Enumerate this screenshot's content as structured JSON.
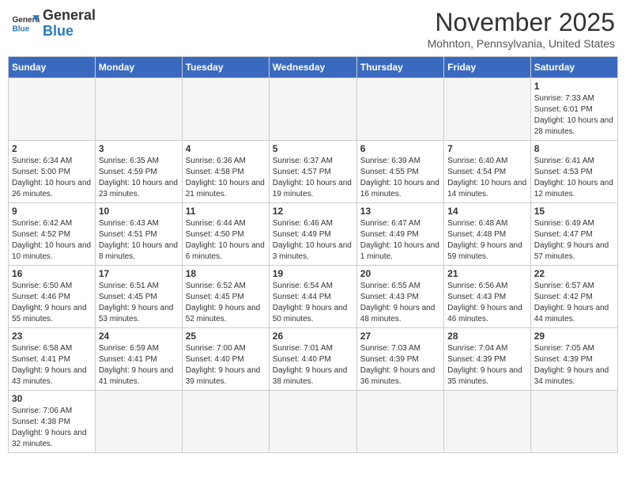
{
  "header": {
    "logo_general": "General",
    "logo_blue": "Blue",
    "title": "November 2025",
    "location": "Mohnton, Pennsylvania, United States"
  },
  "days_of_week": [
    "Sunday",
    "Monday",
    "Tuesday",
    "Wednesday",
    "Thursday",
    "Friday",
    "Saturday"
  ],
  "weeks": [
    [
      {
        "day": "",
        "info": ""
      },
      {
        "day": "",
        "info": ""
      },
      {
        "day": "",
        "info": ""
      },
      {
        "day": "",
        "info": ""
      },
      {
        "day": "",
        "info": ""
      },
      {
        "day": "",
        "info": ""
      },
      {
        "day": "1",
        "info": "Sunrise: 7:33 AM\nSunset: 6:01 PM\nDaylight: 10 hours and 28 minutes."
      }
    ],
    [
      {
        "day": "2",
        "info": "Sunrise: 6:34 AM\nSunset: 5:00 PM\nDaylight: 10 hours and 26 minutes."
      },
      {
        "day": "3",
        "info": "Sunrise: 6:35 AM\nSunset: 4:59 PM\nDaylight: 10 hours and 23 minutes."
      },
      {
        "day": "4",
        "info": "Sunrise: 6:36 AM\nSunset: 4:58 PM\nDaylight: 10 hours and 21 minutes."
      },
      {
        "day": "5",
        "info": "Sunrise: 6:37 AM\nSunset: 4:57 PM\nDaylight: 10 hours and 19 minutes."
      },
      {
        "day": "6",
        "info": "Sunrise: 6:39 AM\nSunset: 4:55 PM\nDaylight: 10 hours and 16 minutes."
      },
      {
        "day": "7",
        "info": "Sunrise: 6:40 AM\nSunset: 4:54 PM\nDaylight: 10 hours and 14 minutes."
      },
      {
        "day": "8",
        "info": "Sunrise: 6:41 AM\nSunset: 4:53 PM\nDaylight: 10 hours and 12 minutes."
      }
    ],
    [
      {
        "day": "9",
        "info": "Sunrise: 6:42 AM\nSunset: 4:52 PM\nDaylight: 10 hours and 10 minutes."
      },
      {
        "day": "10",
        "info": "Sunrise: 6:43 AM\nSunset: 4:51 PM\nDaylight: 10 hours and 8 minutes."
      },
      {
        "day": "11",
        "info": "Sunrise: 6:44 AM\nSunset: 4:50 PM\nDaylight: 10 hours and 6 minutes."
      },
      {
        "day": "12",
        "info": "Sunrise: 6:46 AM\nSunset: 4:49 PM\nDaylight: 10 hours and 3 minutes."
      },
      {
        "day": "13",
        "info": "Sunrise: 6:47 AM\nSunset: 4:49 PM\nDaylight: 10 hours and 1 minute."
      },
      {
        "day": "14",
        "info": "Sunrise: 6:48 AM\nSunset: 4:48 PM\nDaylight: 9 hours and 59 minutes."
      },
      {
        "day": "15",
        "info": "Sunrise: 6:49 AM\nSunset: 4:47 PM\nDaylight: 9 hours and 57 minutes."
      }
    ],
    [
      {
        "day": "16",
        "info": "Sunrise: 6:50 AM\nSunset: 4:46 PM\nDaylight: 9 hours and 55 minutes."
      },
      {
        "day": "17",
        "info": "Sunrise: 6:51 AM\nSunset: 4:45 PM\nDaylight: 9 hours and 53 minutes."
      },
      {
        "day": "18",
        "info": "Sunrise: 6:52 AM\nSunset: 4:45 PM\nDaylight: 9 hours and 52 minutes."
      },
      {
        "day": "19",
        "info": "Sunrise: 6:54 AM\nSunset: 4:44 PM\nDaylight: 9 hours and 50 minutes."
      },
      {
        "day": "20",
        "info": "Sunrise: 6:55 AM\nSunset: 4:43 PM\nDaylight: 9 hours and 48 minutes."
      },
      {
        "day": "21",
        "info": "Sunrise: 6:56 AM\nSunset: 4:43 PM\nDaylight: 9 hours and 46 minutes."
      },
      {
        "day": "22",
        "info": "Sunrise: 6:57 AM\nSunset: 4:42 PM\nDaylight: 9 hours and 44 minutes."
      }
    ],
    [
      {
        "day": "23",
        "info": "Sunrise: 6:58 AM\nSunset: 4:41 PM\nDaylight: 9 hours and 43 minutes."
      },
      {
        "day": "24",
        "info": "Sunrise: 6:59 AM\nSunset: 4:41 PM\nDaylight: 9 hours and 41 minutes."
      },
      {
        "day": "25",
        "info": "Sunrise: 7:00 AM\nSunset: 4:40 PM\nDaylight: 9 hours and 39 minutes."
      },
      {
        "day": "26",
        "info": "Sunrise: 7:01 AM\nSunset: 4:40 PM\nDaylight: 9 hours and 38 minutes."
      },
      {
        "day": "27",
        "info": "Sunrise: 7:03 AM\nSunset: 4:39 PM\nDaylight: 9 hours and 36 minutes."
      },
      {
        "day": "28",
        "info": "Sunrise: 7:04 AM\nSunset: 4:39 PM\nDaylight: 9 hours and 35 minutes."
      },
      {
        "day": "29",
        "info": "Sunrise: 7:05 AM\nSunset: 4:39 PM\nDaylight: 9 hours and 34 minutes."
      }
    ],
    [
      {
        "day": "30",
        "info": "Sunrise: 7:06 AM\nSunset: 4:38 PM\nDaylight: 9 hours and 32 minutes."
      },
      {
        "day": "",
        "info": ""
      },
      {
        "day": "",
        "info": ""
      },
      {
        "day": "",
        "info": ""
      },
      {
        "day": "",
        "info": ""
      },
      {
        "day": "",
        "info": ""
      },
      {
        "day": "",
        "info": ""
      }
    ]
  ]
}
